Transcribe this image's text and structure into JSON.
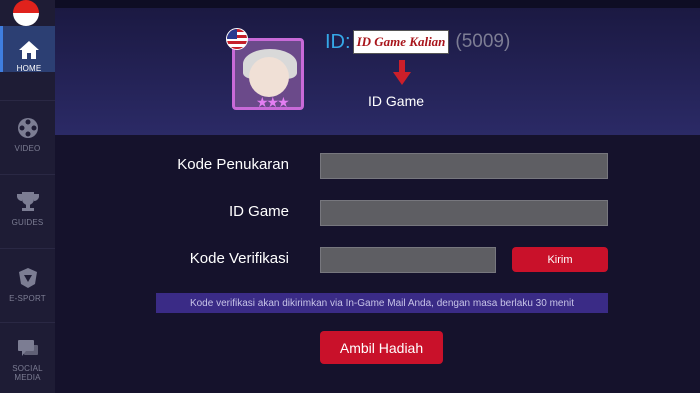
{
  "sidebar": {
    "items": [
      {
        "label": "HOME",
        "icon": "home-icon",
        "active": true
      },
      {
        "label": "VIDEO",
        "icon": "film-reel-icon",
        "active": false
      },
      {
        "label": "GUIDES",
        "icon": "trophy-icon",
        "active": false
      },
      {
        "label": "E-SPORT",
        "icon": "esport-badge-icon",
        "active": false
      },
      {
        "label": "SOCIAL MEDIA",
        "icon": "chat-bubble-icon",
        "active": false
      }
    ]
  },
  "profile": {
    "id_prefix": "ID:",
    "id_placeholder": "ID Game Kalian",
    "server": "(5009)",
    "arrow_caption": "ID Game"
  },
  "form": {
    "redeem_code_label": "Kode Penukaran",
    "game_id_label": "ID Game",
    "verification_label": "Kode Verifikasi",
    "send_button": "Kirim",
    "notice": "Kode verifikasi akan dikirimkan via In-Game Mail Anda, dengan masa berlaku 30 menit",
    "claim_button": "Ambil Hadiah"
  },
  "colors": {
    "accent_red": "#c9112a",
    "id_blue": "#35a8e8",
    "sidebar_active": "#2c3f73"
  }
}
